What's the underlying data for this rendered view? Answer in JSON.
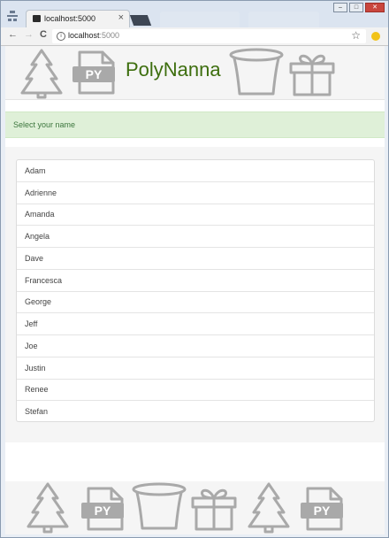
{
  "browser": {
    "tab_title": "localhost:5000",
    "tab_close": "×",
    "url_host": "localhost",
    "url_port": ":5000",
    "back": "←",
    "forward": "→",
    "reload": "C",
    "info": "i",
    "star": "☆"
  },
  "window": {
    "minimize": "–",
    "maximize": "□",
    "close": "✕"
  },
  "page": {
    "brand": "PolyNanna",
    "alert": "Select your name",
    "names": [
      "Adam",
      "Adrienne",
      "Amanda",
      "Angela",
      "Dave",
      "Francesca",
      "George",
      "Jeff",
      "Joe",
      "Justin",
      "Renee",
      "Stefan"
    ],
    "header_icons": [
      "tree-icon",
      "python-file-icon",
      "top-hat-icon",
      "gift-icon"
    ],
    "footer_icons": [
      "tree-icon",
      "python-file-icon",
      "top-hat-icon",
      "gift-icon",
      "tree-icon",
      "python-file-icon"
    ],
    "file_badge": "PY"
  },
  "colors": {
    "brand": "#3d6e0e",
    "alert_bg": "#dff0d8",
    "alert_text": "#3c763d",
    "icon": "#a9a9a9"
  }
}
